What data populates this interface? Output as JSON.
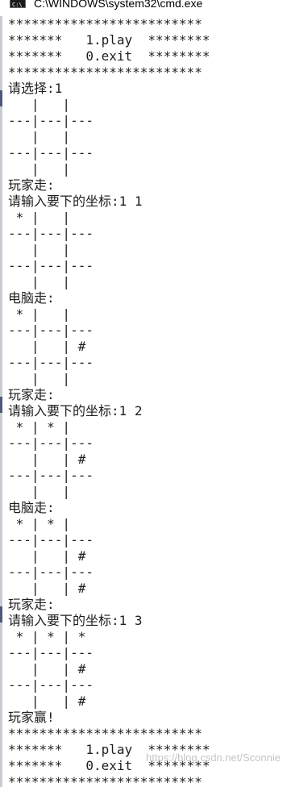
{
  "window": {
    "title": "C:\\WINDOWS\\system32\\cmd.exe",
    "icon": "cmd-console-icon",
    "icon_glyph": "C:\\"
  },
  "console": {
    "lines": [
      "*************************",
      "*******   1.play  ********",
      "*******   0.exit  ********",
      "*************************",
      "请选择:1",
      "   |   |",
      "---|---|---",
      "   |   |",
      "---|---|---",
      "   |   |",
      "玩家走:",
      "请输入要下的坐标:1 1",
      " * |   |",
      "---|---|---",
      "   |   |",
      "---|---|---",
      "   |   |",
      "电脑走:",
      " * |   |",
      "---|---|---",
      "   |   | #",
      "---|---|---",
      "   |   |",
      "玩家走:",
      "请输入要下的坐标:1 2",
      " * | * |",
      "---|---|---",
      "   |   | #",
      "---|---|---",
      "   |   |",
      "电脑走:",
      " * | * |",
      "---|---|---",
      "   |   | #",
      "---|---|---",
      "   |   | #",
      "玩家走:",
      "请输入要下的坐标:1 3",
      " * | * | *",
      "---|---|---",
      "   |   | #",
      "---|---|---",
      "   |   | #",
      "玩家赢!",
      "*************************",
      "*******   1.play  ********",
      "*******   0.exit  ********",
      "*************************"
    ]
  },
  "watermark": {
    "text": "https://blog.csdn.net/Sconnie"
  }
}
